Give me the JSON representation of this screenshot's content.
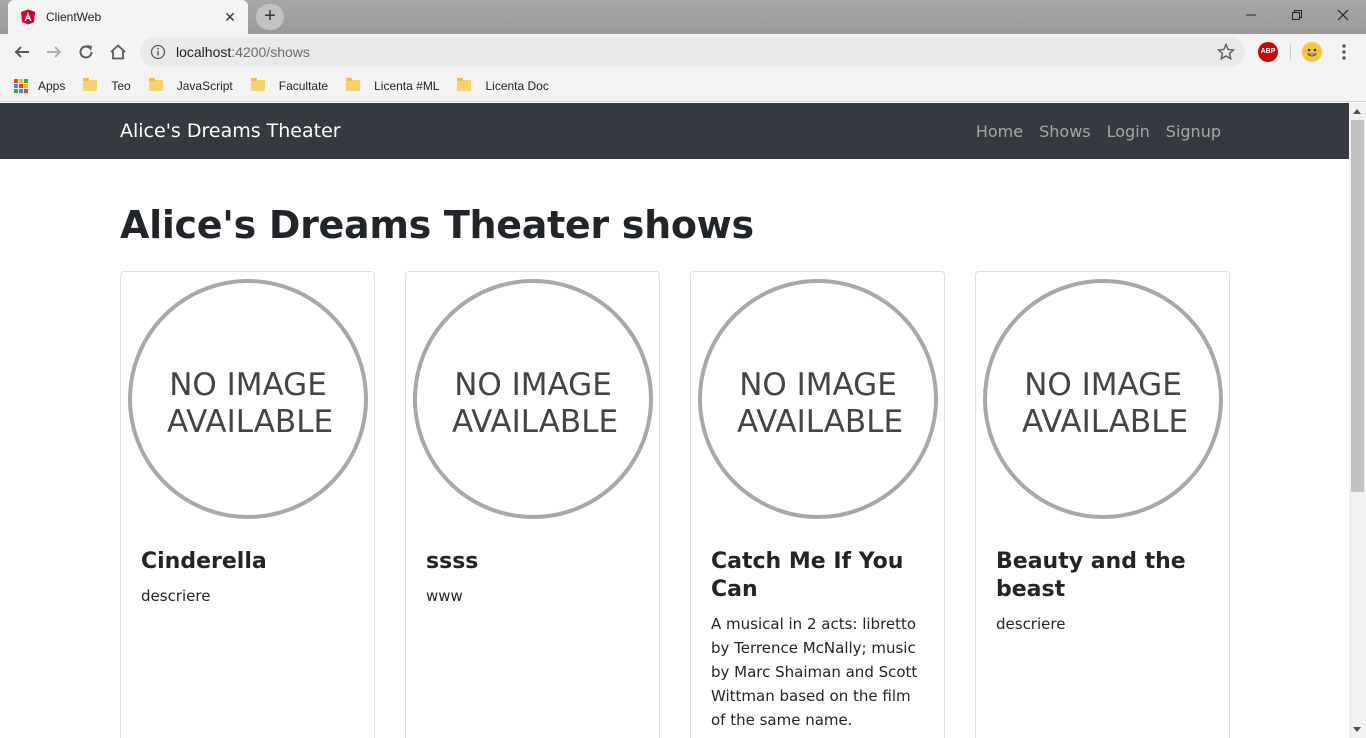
{
  "browser": {
    "tab_title": "ClientWeb",
    "tab_close": "✕",
    "new_tab": "+",
    "url_host": "localhost",
    "url_path": ":4200/shows",
    "bookmarks": [
      {
        "label": "Apps",
        "icon": "apps-icon"
      },
      {
        "label": "Teo",
        "icon": "folder-icon"
      },
      {
        "label": "JavaScript",
        "icon": "folder-icon"
      },
      {
        "label": "Facultate",
        "icon": "folder-icon"
      },
      {
        "label": "Licenta #ML",
        "icon": "folder-icon"
      },
      {
        "label": "Licenta Doc",
        "icon": "folder-icon"
      }
    ],
    "abp_label": "ABP"
  },
  "site": {
    "brand": "Alice's Dreams Theater",
    "nav": [
      "Home",
      "Shows",
      "Login",
      "Signup"
    ],
    "page_title": "Alice's Dreams Theater shows",
    "placeholder_line1": "NO IMAGE",
    "placeholder_line2": "AVAILABLE",
    "cards": [
      {
        "title": "Cinderella",
        "description": "descriere"
      },
      {
        "title": "ssss",
        "description": "www"
      },
      {
        "title": "Catch Me If You Can",
        "description": "A musical in 2 acts: libretto by Terrence McNally; music by Marc Shaiman and Scott Wittman based on the film of the same name."
      },
      {
        "title": "Beauty and the beast",
        "description": "descriere"
      }
    ]
  },
  "colors": {
    "navbar_bg": "#343a40",
    "angular_red": "#dd0031",
    "placeholder_gray": "#a8a8a8"
  }
}
